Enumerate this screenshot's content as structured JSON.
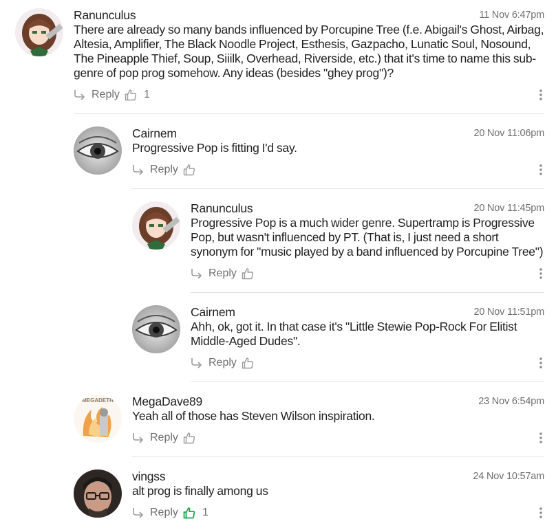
{
  "reply_label": "Reply",
  "colors": {
    "like_active": "#1aa34a",
    "icon_grey": "#9b9b9b"
  },
  "comments": [
    {
      "author": "Ranunculus",
      "time": "11 Nov 6:47pm",
      "text": "There are already so many bands influenced by Porcupine Tree (f.e. Abigail's Ghost, Airbag, Altesia, Amplifier, The Black Noodle Project, Esthesis, Gazpacho, Lunatic Soul, Nosound, The Pineapple Thief, Soup, Siiilk, Overhead, Riverside, etc.) that it's time to name this sub-genre of pop prog somehow. Any ideas (besides \"ghey prog\")?",
      "likes": "1",
      "avatar": "anime-girl-avatar"
    },
    {
      "author": "Cairnem",
      "time": "20 Nov 11:06pm",
      "text": "Progressive Pop is fitting I'd say.",
      "likes": "",
      "avatar": "eye-avatar"
    },
    {
      "author": "Ranunculus",
      "time": "20 Nov 11:45pm",
      "text": "Progressive Pop is a much wider genre. Supertramp is Progressive Pop, but wasn't influenced by PT. (That is, I just need a short synonym for \"music played by a band influenced by Porcupine Tree\")",
      "likes": "",
      "avatar": "anime-girl-avatar"
    },
    {
      "author": "Cairnem",
      "time": "20 Nov 11:51pm",
      "text": "Ahh, ok, got it. In that case it's \"Little Stewie Pop-Rock For Elitist Middle-Aged Dudes\".",
      "likes": "",
      "avatar": "eye-avatar"
    },
    {
      "author": "MegaDave89",
      "time": "23 Nov 6:54pm",
      "text": "Yeah all of those has Steven Wilson inspiration.",
      "likes": "",
      "avatar": "megadeth-avatar",
      "avatar_text": "MEGADETH"
    },
    {
      "author": "vingss",
      "time": "24 Nov 10:57am",
      "text": "alt prog is finally among us",
      "likes": "1",
      "liked": true,
      "avatar": "man-glasses-avatar"
    }
  ]
}
